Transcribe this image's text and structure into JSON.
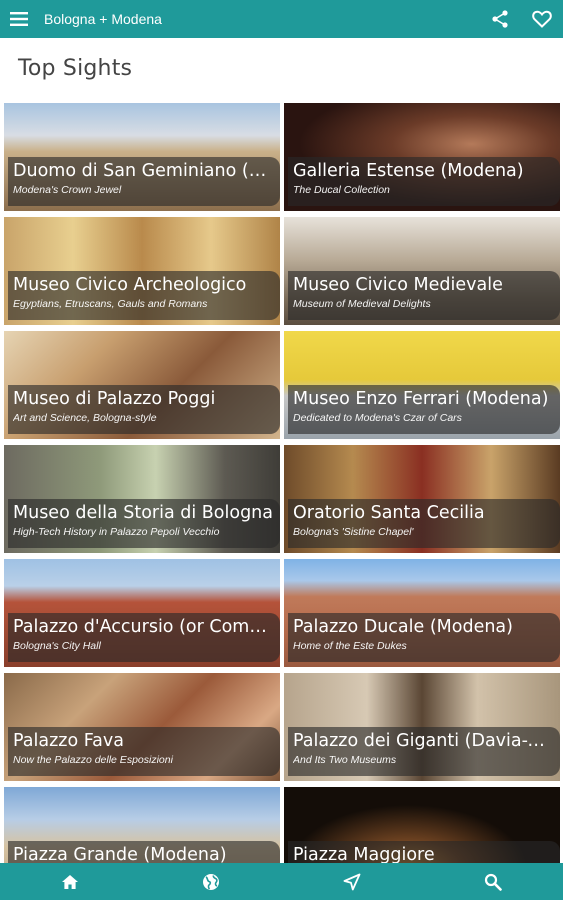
{
  "app": {
    "title": "Bologna + Modena"
  },
  "section": {
    "title": "Top Sights"
  },
  "colors": {
    "accent": "#1f9a9a"
  },
  "sights": [
    {
      "name": "Duomo di San Geminiano (Modena)",
      "subtitle": "Modena's Crown Jewel"
    },
    {
      "name": "Galleria Estense (Modena)",
      "subtitle": "The Ducal Collection"
    },
    {
      "name": "Museo Civico Archeologico",
      "subtitle": "Egyptians, Etruscans, Gauls and Romans"
    },
    {
      "name": "Museo Civico Medievale",
      "subtitle": "Museum of Medieval Delights"
    },
    {
      "name": "Museo di Palazzo Poggi",
      "subtitle": "Art and Science, Bologna-style"
    },
    {
      "name": "Museo Enzo Ferrari (Modena)",
      "subtitle": "Dedicated to Modena's Czar of Cars"
    },
    {
      "name": "Museo della Storia di Bologna",
      "subtitle": "High-Tech History in Palazzo Pepoli Vecchio"
    },
    {
      "name": "Oratorio Santa Cecilia",
      "subtitle": "Bologna's 'Sistine Chapel'"
    },
    {
      "name": "Palazzo d'Accursio (or Comunale)",
      "subtitle": "Bologna's City Hall"
    },
    {
      "name": "Palazzo Ducale (Modena)",
      "subtitle": "Home of the Este Dukes"
    },
    {
      "name": "Palazzo Fava",
      "subtitle": "Now the Palazzo delle Esposizioni"
    },
    {
      "name": "Palazzo dei Giganti (Davia-Bargellini)",
      "subtitle": "And Its Two Museums"
    },
    {
      "name": "Piazza Grande (Modena)",
      "subtitle": ""
    },
    {
      "name": "Piazza Maggiore",
      "subtitle": ""
    }
  ],
  "icons": {
    "menu": "menu-icon",
    "share": "share-icon",
    "favorite": "heart-icon",
    "home": "home-icon",
    "globe": "globe-icon",
    "navigate": "navigation-arrow-icon",
    "search": "search-icon"
  }
}
